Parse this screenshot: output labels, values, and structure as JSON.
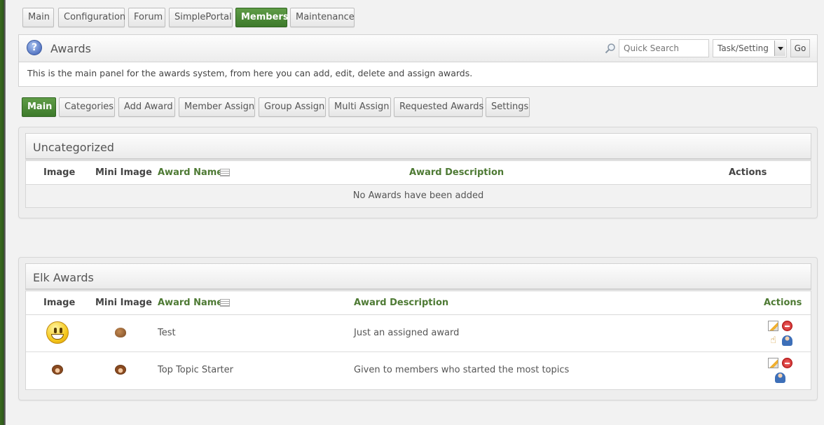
{
  "top_tabs": [
    "Main",
    "Configuration",
    "Forum",
    "SimplePortal",
    "Members",
    "Maintenance"
  ],
  "top_tabs_active": "Members",
  "header": {
    "title": "Awards",
    "search_placeholder": "Quick Search",
    "search_scope": "Task/Setting",
    "go_label": "Go",
    "description": "This is the main panel for the awards system, from here you can add, edit, delete and assign awards."
  },
  "sub_tabs": [
    "Main",
    "Categories",
    "Add Award",
    "Member Assign",
    "Group Assign",
    "Multi Assign",
    "Requested Awards",
    "Settings"
  ],
  "sub_tabs_active": "Main",
  "columns": {
    "image": "Image",
    "mini_image": "Mini Image",
    "award_name": "Award Name",
    "award_description": "Award Description",
    "actions": "Actions"
  },
  "categories": [
    {
      "title": "Uncategorized",
      "empty_message": "No Awards have been added",
      "awards": []
    },
    {
      "title": "Elk Awards",
      "awards": [
        {
          "name": "Test",
          "description": "Just an assigned award",
          "image_icon": "smiley-icon",
          "mini_icon": "acorn-icon",
          "actions": [
            "edit",
            "delete",
            "assign",
            "member"
          ]
        },
        {
          "name": "Top Topic Starter",
          "description": "Given to members who started the most topics",
          "image_icon": "monkey-icon",
          "mini_icon": "monkey-icon",
          "actions": [
            "edit",
            "delete",
            "member"
          ]
        }
      ]
    }
  ],
  "colors": {
    "accent": "#4e8a36",
    "link": "#4e7a34"
  }
}
